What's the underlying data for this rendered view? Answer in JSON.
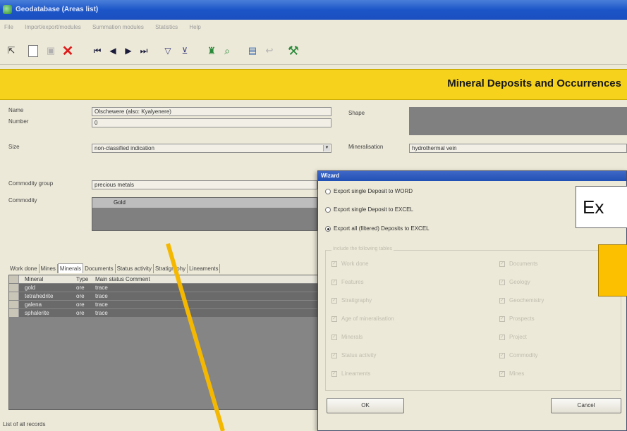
{
  "window": {
    "title": "Geodatabase (Areas list)"
  },
  "menu": [
    "File",
    "Import/export/modules",
    "Summation modules",
    "Statistics",
    "Help"
  ],
  "toolbar": {
    "buttons": [
      "select",
      "new",
      "save",
      "delete",
      "first",
      "previous",
      "next",
      "last",
      "filter",
      "remove-filter",
      "find",
      "find-next",
      "report",
      "close",
      "tools"
    ]
  },
  "header": {
    "title": "Mineral Deposits and Occurrences"
  },
  "form": {
    "name_label": "Name",
    "name_value": "Olschewere (also: Kyalyenere)",
    "number_label": "Number",
    "number_value": "0",
    "size_label": "Size",
    "size_value": "non-classified indication",
    "shape_label": "Shape",
    "mineralisation_label": "Mineralisation",
    "mineralisation_value": "hydrothermal vein",
    "commodity_group_label": "Commodity group",
    "commodity_group_value": "precious metals",
    "commodity_label": "Commodity",
    "commodity_value": "Gold"
  },
  "tabs": [
    "Work done",
    "Mines",
    "Minerals",
    "Documents",
    "Status activity",
    "Stratigraphy",
    "Lineaments"
  ],
  "minerals_table": {
    "columns": [
      "Mineral",
      "Type",
      "Main status",
      "Comment"
    ],
    "rows": [
      [
        "gold",
        "ore",
        "trace",
        ""
      ],
      [
        "tetrahedrite",
        "ore",
        "trace",
        ""
      ],
      [
        "galena",
        "ore",
        "trace",
        ""
      ],
      [
        "sphalerite",
        "ore",
        "trace",
        ""
      ]
    ]
  },
  "statusbar": {
    "text": "List of all records"
  },
  "wizard": {
    "title": "Wizard",
    "options": [
      "Export single Deposit to WORD",
      "Export single Deposit to EXCEL",
      "Export all (filtered) Deposits to EXCEL"
    ],
    "selected_option": 2,
    "group_label": "Include the following tables",
    "checkboxes_left": [
      "Work done",
      "Features",
      "Stratigraphy",
      "Age of mineralisation",
      "Minerals",
      "Status activity",
      "Lineaments"
    ],
    "checkboxes_right": [
      "Documents",
      "Geology",
      "Geochemistry",
      "Prospects",
      "Project",
      "Commodity",
      "Mines"
    ],
    "ok_label": "OK",
    "cancel_label": "Cancel"
  },
  "callout": {
    "text": "Ex"
  },
  "colors": {
    "header_band": "#f6d21c",
    "callout_box": "#fdc000",
    "pointer_line": "#f5b800",
    "grid_bg": "#858585"
  }
}
